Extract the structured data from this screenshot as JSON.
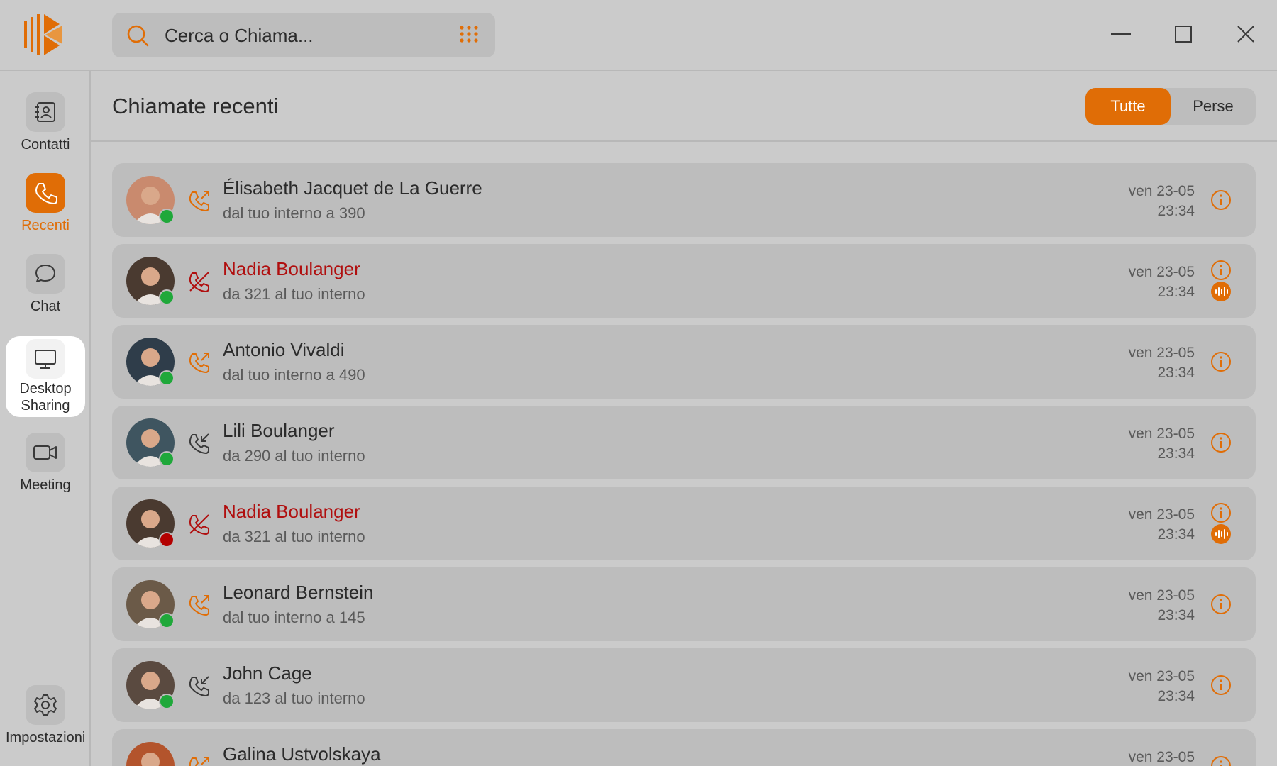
{
  "app": {
    "search_placeholder": "Cerca o Chiama...",
    "accent": "#e06d06",
    "missed_color": "#b00f0f",
    "online_color": "#1fa83a",
    "busy_color": "#b30000"
  },
  "sidebar": {
    "items": [
      {
        "label": "Contatti",
        "icon": "contacts-book-icon"
      },
      {
        "label": "Recenti",
        "icon": "phone-icon",
        "active": true
      },
      {
        "label": "Chat",
        "icon": "chat-bubble-icon"
      },
      {
        "label": "Desktop Sharing",
        "label_line1": "Desktop",
        "label_line2": "Sharing",
        "icon": "monitor-icon"
      },
      {
        "label": "Meeting",
        "icon": "video-camera-icon"
      },
      {
        "label": "Impostazioni",
        "icon": "gear-icon"
      }
    ]
  },
  "main": {
    "title": "Chiamate recenti",
    "filters": [
      {
        "label": "Tutte",
        "selected": true
      },
      {
        "label": "Perse",
        "selected": false
      }
    ],
    "calls": [
      {
        "name": "Élisabeth Jacquet de La Guerre",
        "detail": "dal tuo interno a 390",
        "day": "ven 23-05",
        "time": "23:34",
        "type": "outgoing",
        "status": "online",
        "recording": false
      },
      {
        "name": "Nadia Boulanger",
        "detail": "da 321 al tuo interno",
        "day": "ven 23-05",
        "time": "23:34",
        "type": "missed",
        "status": "online",
        "recording": true
      },
      {
        "name": "Antonio Vivaldi",
        "detail": "dal tuo interno a 490",
        "day": "ven 23-05",
        "time": "23:34",
        "type": "outgoing",
        "status": "online",
        "recording": false
      },
      {
        "name": "Lili Boulanger",
        "detail": "da 290 al tuo interno",
        "day": "ven 23-05",
        "time": "23:34",
        "type": "incoming",
        "status": "online",
        "recording": false
      },
      {
        "name": "Nadia Boulanger",
        "detail": "da 321 al tuo interno",
        "day": "ven 23-05",
        "time": "23:34",
        "type": "missed",
        "status": "busy",
        "recording": true
      },
      {
        "name": "Leonard Bernstein",
        "detail": "dal tuo interno a 145",
        "day": "ven 23-05",
        "time": "23:34",
        "type": "outgoing",
        "status": "online",
        "recording": false
      },
      {
        "name": "John Cage",
        "detail": "da 123 al tuo interno",
        "day": "ven 23-05",
        "time": "23:34",
        "type": "incoming",
        "status": "online",
        "recording": false
      },
      {
        "name": "Galina Ustvolskaya",
        "detail": "",
        "day": "ven 23-05",
        "time": "",
        "type": "outgoing",
        "status": "online",
        "recording": false
      }
    ]
  }
}
